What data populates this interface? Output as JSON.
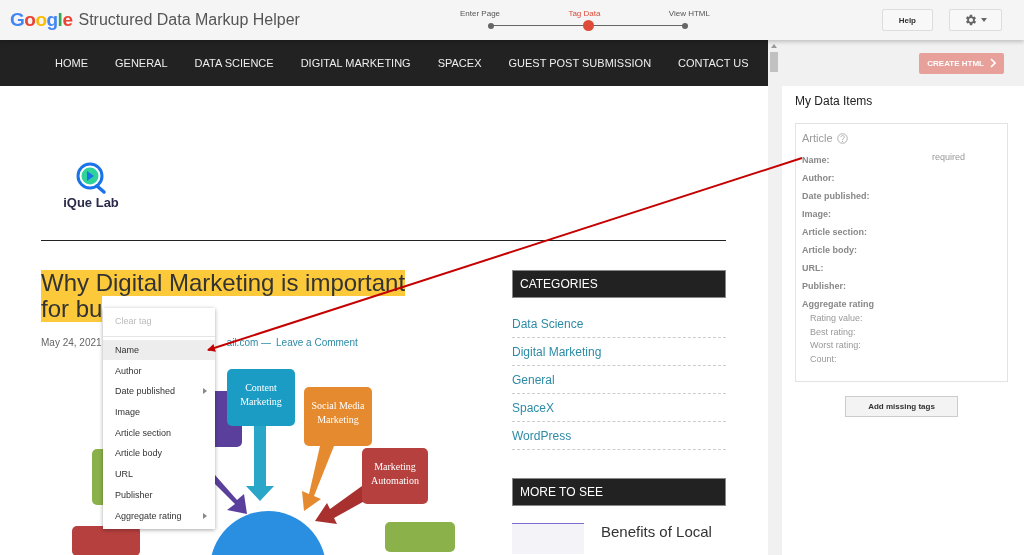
{
  "app_bar": {
    "logo": "Google",
    "title": "Structured Data Markup Helper",
    "help_button": "Help"
  },
  "steps": [
    {
      "label": "Enter Page",
      "selected": false
    },
    {
      "label": "Tag Data",
      "selected": true
    },
    {
      "label": "View HTML",
      "selected": false
    }
  ],
  "site": {
    "nav": [
      "HOME",
      "GENERAL",
      "DATA SCIENCE",
      "DIGITAL MARKETING",
      "SPACEX",
      "GUEST POST SUBMISSION",
      "CONTACT US"
    ],
    "logo_text": "iQue Lab",
    "post_title_lines": [
      "Why Digital Marketing is important",
      "for bu"
    ],
    "post_date": "May 24, 2021",
    "post_author": "ail.com —",
    "comment_link": "Leave a Comment",
    "infographic_boxes": [
      {
        "label": "Content Marketing",
        "color": "#1b9cc4"
      },
      {
        "label": "Social Media Marketing",
        "color": "#e58a2e"
      },
      {
        "label": "Marketing Automation",
        "color": "#b6403e"
      }
    ],
    "categories_title": "CATEGORIES",
    "categories": [
      "Data Science",
      "Digital Marketing",
      "General",
      "SpaceX",
      "WordPress"
    ],
    "more_title": "MORE TO SEE",
    "more_post_title": "Benefits of Local"
  },
  "context_menu": {
    "clear_item": {
      "label": "Clear tag",
      "disabled": true
    },
    "items": [
      {
        "label": "Name",
        "selected": true,
        "submenu": false
      },
      {
        "label": "Author",
        "selected": false,
        "submenu": false
      },
      {
        "label": "Date published",
        "selected": false,
        "submenu": true
      },
      {
        "label": "Image",
        "selected": false,
        "submenu": false
      },
      {
        "label": "Article section",
        "selected": false,
        "submenu": false
      },
      {
        "label": "Article body",
        "selected": false,
        "submenu": false
      },
      {
        "label": "URL",
        "selected": false,
        "submenu": false
      },
      {
        "label": "Publisher",
        "selected": false,
        "submenu": false
      },
      {
        "label": "Aggregate rating",
        "selected": false,
        "submenu": true
      }
    ]
  },
  "panel": {
    "create_button": "CREATE HTML",
    "title": "My Data Items",
    "item_type": "Article",
    "fields": [
      {
        "label": "Name:",
        "hint": "required"
      },
      {
        "label": "Author:"
      },
      {
        "label": "Date published:"
      },
      {
        "label": "Image:"
      },
      {
        "label": "Article section:"
      },
      {
        "label": "Article body:"
      },
      {
        "label": "URL:"
      },
      {
        "label": "Publisher:"
      },
      {
        "label": "Aggregate rating",
        "children": [
          {
            "label": "Rating value:"
          },
          {
            "label": "Best rating:"
          },
          {
            "label": "Worst rating:"
          },
          {
            "label": "Count:"
          }
        ]
      }
    ],
    "add_button": "Add missing tags"
  }
}
